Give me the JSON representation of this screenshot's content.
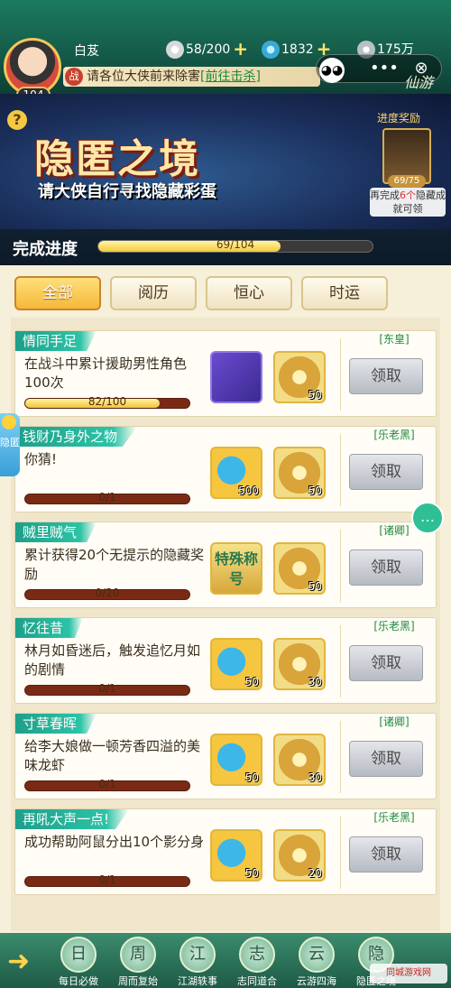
{
  "header": {
    "player_name": "白芨",
    "level": "104",
    "resources": [
      {
        "icon": "silver-ingot-icon",
        "value": "58/200",
        "has_plus": true
      },
      {
        "icon": "jade-coin-icon",
        "value": "1832",
        "has_plus": true
      },
      {
        "icon": "coin-icon",
        "value": "175万",
        "has_plus": false
      }
    ],
    "notice_badge": "战",
    "notice_text": "请各位大侠前来除害",
    "notice_link": "[前往击杀]",
    "logo_text": "仙游",
    "capsule": {
      "more": "•••",
      "close": "⊗"
    }
  },
  "banner": {
    "help": "?",
    "title": "隐匿之境",
    "subtitle": "请大侠自行寻找隐藏彩蛋",
    "reward_title": "进度奖励",
    "reward_count": "69/75",
    "reward_note_pre": "再完成",
    "reward_note_num": "6个",
    "reward_note_post": "隐藏成就可领"
  },
  "progress": {
    "label": "完成进度",
    "text": "69/104",
    "value": 69,
    "max": 104
  },
  "tabs": [
    {
      "label": "全部",
      "active": true
    },
    {
      "label": "阅历",
      "active": false
    },
    {
      "label": "恒心",
      "active": false
    },
    {
      "label": "时运",
      "active": false
    }
  ],
  "tasks": [
    {
      "title": "情同手足",
      "desc": "在战斗中累计援助男性角色100次",
      "progress_text": "82/100",
      "progress": 0.82,
      "rewards": [
        {
          "kind": "chest",
          "icon": "treasure-chest-icon",
          "num": ""
        },
        {
          "kind": "jade",
          "icon": "jade-token-icon",
          "num": "50"
        }
      ],
      "npc": "[东皇]",
      "button": "领取"
    },
    {
      "title": "钱财乃身外之物",
      "desc": "你猜!",
      "progress_text": "0/1",
      "progress": 0,
      "rewards": [
        {
          "kind": "fan",
          "icon": "fan-token-icon",
          "num": "500"
        },
        {
          "kind": "jade",
          "icon": "jade-token-icon",
          "num": "50"
        }
      ],
      "npc": "[乐老黑]",
      "button": "领取"
    },
    {
      "title": "贼里贼气",
      "desc": "累计获得20个无提示的隐藏奖励",
      "progress_text": "0/20",
      "progress": 0,
      "rewards": [
        {
          "kind": "title",
          "icon": "special-title-icon",
          "num": "",
          "label": "特殊称号"
        },
        {
          "kind": "jade",
          "icon": "jade-token-icon",
          "num": "50"
        }
      ],
      "npc": "[诸卿]",
      "button": "领取"
    },
    {
      "title": "忆往昔",
      "desc": "林月如昏迷后，触发追忆月如的剧情",
      "progress_text": "0/1",
      "progress": 0,
      "rewards": [
        {
          "kind": "fan",
          "icon": "fan-token-icon",
          "num": "50"
        },
        {
          "kind": "jade",
          "icon": "jade-token-icon",
          "num": "30"
        }
      ],
      "npc": "[乐老黑]",
      "button": "领取"
    },
    {
      "title": "寸草春晖",
      "desc": "给李大娘做一顿芳香四溢的美味龙虾",
      "progress_text": "0/1",
      "progress": 0,
      "rewards": [
        {
          "kind": "fan",
          "icon": "fan-token-icon",
          "num": "50"
        },
        {
          "kind": "jade",
          "icon": "jade-token-icon",
          "num": "30"
        }
      ],
      "npc": "[诸卿]",
      "button": "领取"
    },
    {
      "title": "再吼大声一点!",
      "desc": "成功帮助阿鼠分出10个影分身",
      "progress_text": "0/1",
      "progress": 0,
      "rewards": [
        {
          "kind": "fan",
          "icon": "fan-token-icon",
          "num": "50"
        },
        {
          "kind": "jade",
          "icon": "jade-token-icon",
          "num": "20"
        }
      ],
      "npc": "[乐老黑]",
      "button": "领取"
    }
  ],
  "sidetab": {
    "label": "隐匿"
  },
  "bottom_nav": [
    {
      "label": "每日必做",
      "glyph": "日"
    },
    {
      "label": "周而复始",
      "glyph": "周"
    },
    {
      "label": "江湖轶事",
      "glyph": "江"
    },
    {
      "label": "志同道合",
      "glyph": "志"
    },
    {
      "label": "云游四海",
      "glyph": "云"
    },
    {
      "label": "隐匿之境",
      "glyph": "隐"
    }
  ],
  "watermark": "同城游戏网",
  "colors": {
    "accent_teal": "#1e9f8a",
    "gold": "#f5b83a",
    "npc_green": "#1f8a3a"
  }
}
